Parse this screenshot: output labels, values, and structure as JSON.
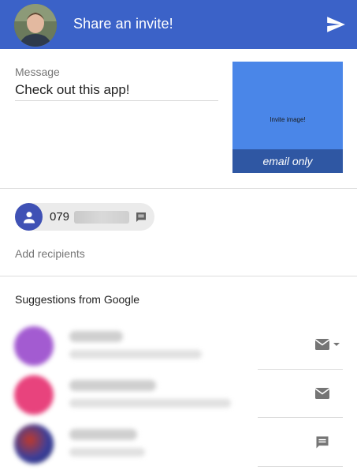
{
  "header": {
    "title": "Share an invite!",
    "avatar_icon": "user-photo",
    "send_icon": "send-icon",
    "bg_color": "#3b62c8"
  },
  "message": {
    "label": "Message",
    "value": "Check out this app!"
  },
  "invite_image": {
    "label": "Invite image!",
    "caption": "email only",
    "bg_color": "#4a86e8",
    "caption_bg": "#2f57a3"
  },
  "recipients": {
    "chip": {
      "number_visible": "079",
      "icon": "person-icon",
      "type_icon": "sms-icon"
    },
    "add_placeholder": "Add recipients"
  },
  "suggestions": {
    "title": "Suggestions from Google",
    "items": [
      {
        "avatar_color": "#a35bd1",
        "action_icon": "email-dropdown-icon"
      },
      {
        "avatar_color": "#e8437d",
        "action_icon": "email-icon"
      },
      {
        "avatar_color": "#3a3f9c",
        "action_icon": "sms-icon"
      }
    ]
  }
}
